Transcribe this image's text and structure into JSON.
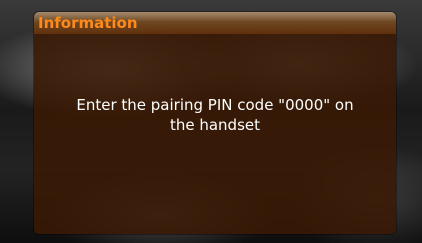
{
  "dialog": {
    "title": "Information",
    "message_lines": [
      "Enter the pairing PIN code \"0000\" on",
      "the handset"
    ]
  },
  "colors": {
    "title_text": "#ff8a1c",
    "message_text": "#ffffff",
    "dialog_background": "#3a1a04"
  }
}
